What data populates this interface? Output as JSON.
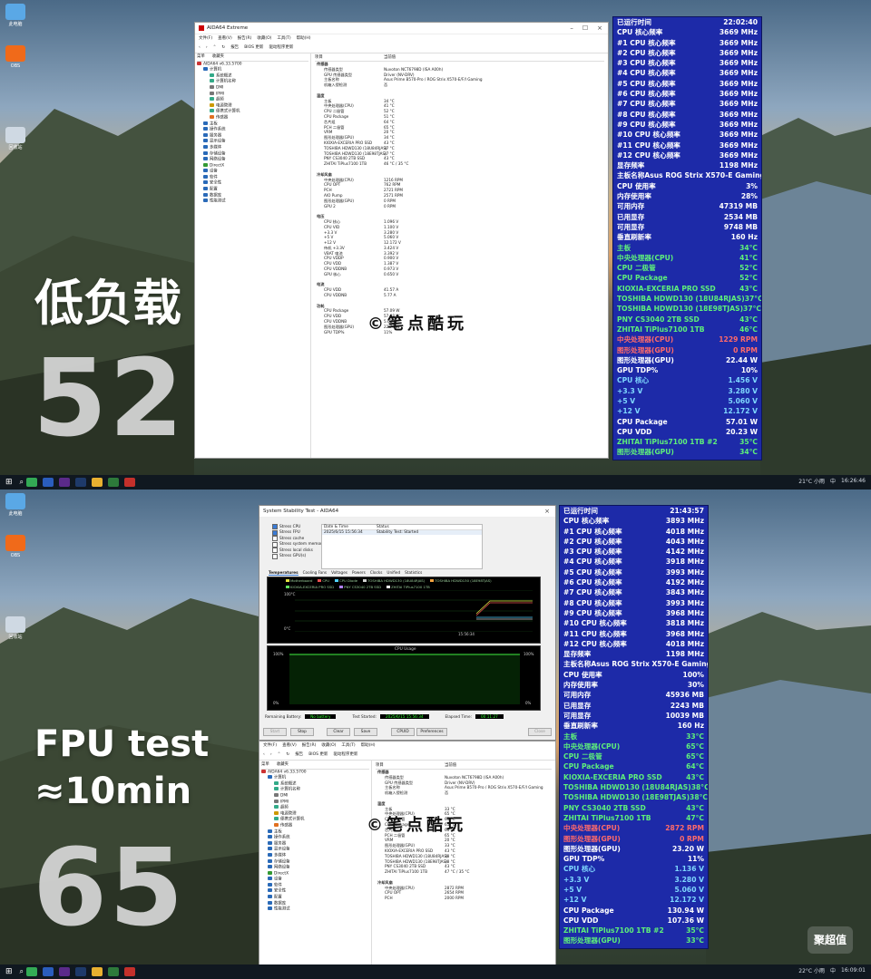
{
  "top": {
    "desktop_icons": [
      "此电脑",
      "OBS",
      "回收站"
    ],
    "overlay_title": "低负载",
    "overlay_number": "52",
    "watermark": "©笔点酷玩",
    "aida": {
      "title": "AIDA64 Extreme",
      "menus": [
        "文件(F)",
        "查看(V)",
        "报告(R)",
        "收藏(O)",
        "工具(T)",
        "帮助(H)"
      ],
      "toolbar": [
        "报告",
        "BIOS 更新",
        "驱动程序更新"
      ],
      "tree_tabs": [
        "菜单",
        "收藏夹"
      ],
      "tree": [
        "AIDA64 v6.33.5700",
        "计算机",
        "系统概述",
        "计算机名称",
        "DMI",
        "IPMI",
        "超频",
        "电源管理",
        "便携式计算机",
        "传感器",
        "主板",
        "操作系统",
        "服务器",
        "显示设备",
        "多媒体",
        "存储设备",
        "网络设备",
        "DirectX",
        "设备",
        "软件",
        "安全性",
        "配置",
        "数据库",
        "性能测试"
      ],
      "col_headers": [
        "项目",
        "当前值"
      ],
      "rows": [
        {
          "k": "传感器",
          "v": "",
          "sec": true
        },
        {
          "k": "传感器类型",
          "v": "Nuvoton NCT6798D (ISA A00h)"
        },
        {
          "k": "GPU 传感器类型",
          "v": "Driver (NV-DRV)"
        },
        {
          "k": "主板名称",
          "v": "Asus Prime B570-Pro / ROG Strix X570-E/F/I Gaming"
        },
        {
          "k": "机箱入侵检测",
          "v": "否"
        },
        {
          "k": "",
          "v": ""
        },
        {
          "k": "温度",
          "v": "",
          "sec": true
        },
        {
          "k": "主板",
          "v": "34 °C"
        },
        {
          "k": "中央处理器(CPU)",
          "v": "41 °C"
        },
        {
          "k": "CPU 二极管",
          "v": "52 °C"
        },
        {
          "k": "CPU Package",
          "v": "51 °C"
        },
        {
          "k": "芯片组",
          "v": "64 °C"
        },
        {
          "k": "PCH 二极管",
          "v": "65 °C"
        },
        {
          "k": "VRM",
          "v": "20 °C"
        },
        {
          "k": "图形处理器(GPU)",
          "v": "34 °C"
        },
        {
          "k": "KIOXIA-EXCERIA PRO SSD",
          "v": "43 °C"
        },
        {
          "k": "TOSHIBA HDWD130 (18U84RJAS)",
          "v": "37 °C"
        },
        {
          "k": "TOSHIBA HDWD130 (18E98TJAS)",
          "v": "37 °C"
        },
        {
          "k": "PNY CS3040 2TB SSD",
          "v": "43 °C"
        },
        {
          "k": "ZHITAI TiPlus7100 1TB",
          "v": "46 °C / 35 °C"
        },
        {
          "k": "",
          "v": ""
        },
        {
          "k": "冷却风扇",
          "v": "",
          "sec": true
        },
        {
          "k": "中央处理器(CPU)",
          "v": "1216 RPM"
        },
        {
          "k": "CPU OPT",
          "v": "762 RPM"
        },
        {
          "k": "PCH",
          "v": "2721 RPM"
        },
        {
          "k": "AIO Pump",
          "v": "2571 RPM"
        },
        {
          "k": "图形处理器(GPU)",
          "v": "0 RPM"
        },
        {
          "k": "GPU 2",
          "v": "0 RPM"
        },
        {
          "k": "",
          "v": ""
        },
        {
          "k": "电压",
          "v": "",
          "sec": true
        },
        {
          "k": "CPU 核心",
          "v": "1.096 V"
        },
        {
          "k": "CPU VID",
          "v": "1.100 V"
        },
        {
          "k": "+3.3 V",
          "v": "3.280 V"
        },
        {
          "k": "+5 V",
          "v": "5.060 V"
        },
        {
          "k": "+12 V",
          "v": "12.172 V"
        },
        {
          "k": "待机 +3.3V",
          "v": "3.424 V"
        },
        {
          "k": "VBAT 电池",
          "v": "3.392 V"
        },
        {
          "k": "CPU VDDP",
          "v": "0.900 V"
        },
        {
          "k": "CPU VDD",
          "v": "1.387 V"
        },
        {
          "k": "CPU VDDNB",
          "v": "0.973 V"
        },
        {
          "k": "GPU 核心",
          "v": "0.650 V"
        },
        {
          "k": "",
          "v": ""
        },
        {
          "k": "电流",
          "v": "",
          "sec": true
        },
        {
          "k": "CPU VDD",
          "v": "41.57 A"
        },
        {
          "k": "CPU VDDNB",
          "v": "5.77 A"
        },
        {
          "k": "",
          "v": ""
        },
        {
          "k": "功耗",
          "v": "",
          "sec": true
        },
        {
          "k": "CPU Package",
          "v": "57.09 W"
        },
        {
          "k": "CPU VDD",
          "v": "57.68 W"
        },
        {
          "k": "CPU VDDNB",
          "v": "5.63 W"
        },
        {
          "k": "图形处理器(GPU)",
          "v": "22.79 W"
        },
        {
          "k": "GPU TDP%",
          "v": "11%"
        }
      ]
    },
    "osd": [
      {
        "k": "已运行时间",
        "v": "22:02:40",
        "c": "#ffffff"
      },
      {
        "k": "CPU 核心频率",
        "v": "3669 MHz",
        "c": "#ffffff"
      },
      {
        "k": "#1 CPU 核心频率",
        "v": "3669 MHz",
        "c": "#ffffff"
      },
      {
        "k": "#2 CPU 核心频率",
        "v": "3669 MHz",
        "c": "#ffffff"
      },
      {
        "k": "#3 CPU 核心频率",
        "v": "3669 MHz",
        "c": "#ffffff"
      },
      {
        "k": "#4 CPU 核心频率",
        "v": "3669 MHz",
        "c": "#ffffff"
      },
      {
        "k": "#5 CPU 核心频率",
        "v": "3669 MHz",
        "c": "#ffffff"
      },
      {
        "k": "#6 CPU 核心频率",
        "v": "3669 MHz",
        "c": "#ffffff"
      },
      {
        "k": "#7 CPU 核心频率",
        "v": "3669 MHz",
        "c": "#ffffff"
      },
      {
        "k": "#8 CPU 核心频率",
        "v": "3669 MHz",
        "c": "#ffffff"
      },
      {
        "k": "#9 CPU 核心频率",
        "v": "3669 MHz",
        "c": "#ffffff"
      },
      {
        "k": "#10 CPU 核心频率",
        "v": "3669 MHz",
        "c": "#ffffff"
      },
      {
        "k": "#11 CPU 核心频率",
        "v": "3669 MHz",
        "c": "#ffffff"
      },
      {
        "k": "#12 CPU 核心频率",
        "v": "3669 MHz",
        "c": "#ffffff"
      },
      {
        "k": "显存频率",
        "v": "1198 MHz",
        "c": "#ffffff"
      },
      {
        "k": "主板名称",
        "v": "Asus ROG Strix X570-E Gaming",
        "c": "#ffffff"
      },
      {
        "k": "CPU 使用率",
        "v": "3%",
        "c": "#ffffff"
      },
      {
        "k": "内存使用率",
        "v": "28%",
        "c": "#ffffff"
      },
      {
        "k": "可用内存",
        "v": "47319 MB",
        "c": "#ffffff"
      },
      {
        "k": "已用显存",
        "v": "2534 MB",
        "c": "#ffffff"
      },
      {
        "k": "可用显存",
        "v": "9748 MB",
        "c": "#ffffff"
      },
      {
        "k": "垂直刷新率",
        "v": "160 Hz",
        "c": "#ffffff"
      },
      {
        "k": "主板",
        "v": "34°C",
        "c": "#5ef07a"
      },
      {
        "k": "中央处理器(CPU)",
        "v": "41°C",
        "c": "#5ef07a"
      },
      {
        "k": "CPU 二极管",
        "v": "52°C",
        "c": "#5ef07a"
      },
      {
        "k": "CPU Package",
        "v": "52°C",
        "c": "#5ef07a"
      },
      {
        "k": "KIOXIA-EXCERIA PRO SSD",
        "v": "43°C",
        "c": "#5ef07a"
      },
      {
        "k": "TOSHIBA HDWD130 (18U84RJAS)",
        "v": "37°C",
        "c": "#5ef07a"
      },
      {
        "k": "TOSHIBA HDWD130 (18E98TJAS)",
        "v": "37°C",
        "c": "#5ef07a"
      },
      {
        "k": "PNY CS3040 2TB SSD",
        "v": "43°C",
        "c": "#5ef07a"
      },
      {
        "k": "ZHITAI TiPlus7100 1TB",
        "v": "46°C",
        "c": "#5ef07a"
      },
      {
        "k": "中央处理器(CPU)",
        "v": "1229 RPM",
        "c": "#ff6a6a"
      },
      {
        "k": "图形处理器(GPU)",
        "v": "0 RPM",
        "c": "#ff6a6a"
      },
      {
        "k": "图形处理器(GPU)",
        "v": "22.44 W",
        "c": "#ffffff"
      },
      {
        "k": "GPU TDP%",
        "v": "10%",
        "c": "#ffffff"
      },
      {
        "k": "CPU 核心",
        "v": "1.456 V",
        "c": "#7fd8ff"
      },
      {
        "k": "+3.3 V",
        "v": "3.280 V",
        "c": "#7fd8ff"
      },
      {
        "k": "+5 V",
        "v": "5.060 V",
        "c": "#7fd8ff"
      },
      {
        "k": "+12 V",
        "v": "12.172 V",
        "c": "#7fd8ff"
      },
      {
        "k": "CPU Package",
        "v": "57.01 W",
        "c": "#ffffff"
      },
      {
        "k": "CPU VDD",
        "v": "20.23 W",
        "c": "#ffffff"
      },
      {
        "k": "ZHITAI TiPlus7100 1TB #2",
        "v": "35°C",
        "c": "#5ef07a"
      },
      {
        "k": "图形处理器(GPU)",
        "v": "34°C",
        "c": "#5ef07a"
      }
    ],
    "tray": {
      "weather": "21°C 小雨",
      "ime": "中",
      "time": "16:26:46"
    }
  },
  "bottom": {
    "desktop_icons": [
      "此电脑",
      "OBS",
      "回收站"
    ],
    "overlay_title_1": "FPU test",
    "overlay_title_2": "≈10min",
    "overlay_number": "65",
    "watermark": "©笔点酷玩",
    "stability": {
      "title": "System Stability Test - AIDA64",
      "checks": [
        {
          "label": "Stress CPU",
          "on": true
        },
        {
          "label": "Stress FPU",
          "on": true
        },
        {
          "label": "Stress cache",
          "on": false
        },
        {
          "label": "Stress system memory",
          "on": false
        },
        {
          "label": "Stress local disks",
          "on": false
        },
        {
          "label": "Stress GPU(s)",
          "on": false
        }
      ],
      "log_headers": [
        "Date & Time",
        "Status"
      ],
      "log_date": "2025/6/15 15:56:34",
      "log_status": "Stability Test: Started",
      "tabs": [
        "Temperatures",
        "Cooling Fans",
        "Voltages",
        "Powers",
        "Clocks",
        "Unified",
        "Statistics"
      ],
      "legend": [
        "Motherboard",
        "CPU",
        "CPU Diode",
        "TOSHIBA HDWD130 (18U84RJAS)",
        "TOSHIBA HDWD130 (18E98TJAS)",
        "KIOXIA-EXCERIA PRO SSD",
        "PNY CS3040 2TB SSD",
        "ZHITAI TiPlus7100 1TB"
      ],
      "graph1_top": "100°C",
      "graph1_bottom": "0°C",
      "graph1_time": "15:56:34",
      "graph2_title": "CPU Usage",
      "graph2_top_left": "100%",
      "graph2_top_right": "100%",
      "graph2_bottom_left": "0%",
      "graph2_bottom_right": "0%",
      "remaining_label": "Remaining Battery:",
      "remaining_value": "No battery",
      "started_label": "Test Started:",
      "started_value": "2025/6/15 15:56:34",
      "elapsed_label": "Elapsed Time:",
      "elapsed_value": "00:11:27",
      "buttons": [
        "Start",
        "Stop",
        "Clear",
        "Save",
        "CPUID",
        "Preferences",
        "Close"
      ]
    },
    "aida": {
      "menus": [
        "文件(F)",
        "查看(V)",
        "报告(R)",
        "收藏(O)",
        "工具(T)",
        "帮助(H)"
      ],
      "toolbar": [
        "报告",
        "BIOS 更新",
        "驱动程序更新"
      ],
      "tree_tabs": [
        "菜单",
        "收藏夹"
      ],
      "tree": [
        "AIDA64 v6.33.5700",
        "计算机",
        "系统概述",
        "计算机名称",
        "DMI",
        "IPMI",
        "超频",
        "电源管理",
        "便携式计算机",
        "传感器",
        "主板",
        "操作系统",
        "服务器",
        "显示设备",
        "多媒体",
        "存储设备",
        "网络设备",
        "DirectX",
        "设备",
        "软件",
        "安全性",
        "配置",
        "数据库",
        "性能测试"
      ],
      "col_headers": [
        "项目",
        "当前值"
      ],
      "rows": [
        {
          "k": "传感器",
          "v": "",
          "sec": true
        },
        {
          "k": "传感器类型",
          "v": "Nuvoton NCT6798D (ISA A00h)"
        },
        {
          "k": "GPU 传感器类型",
          "v": "Driver (NV-DRV)"
        },
        {
          "k": "主板名称",
          "v": "Asus Prime B570-Pro / ROG Strix X570-E/F/I Gaming"
        },
        {
          "k": "机箱入侵检测",
          "v": "否"
        },
        {
          "k": "",
          "v": ""
        },
        {
          "k": "温度",
          "v": "",
          "sec": true
        },
        {
          "k": "主板",
          "v": "33 °C"
        },
        {
          "k": "中央处理器(CPU)",
          "v": "65 °C"
        },
        {
          "k": "CPU 二极管",
          "v": "65 °C"
        },
        {
          "k": "CPU Package",
          "v": "65 °C"
        },
        {
          "k": "芯片组",
          "v": "65 °C"
        },
        {
          "k": "PCH 二极管",
          "v": "65 °C"
        },
        {
          "k": "VRM",
          "v": "20 °C"
        },
        {
          "k": "图形处理器(GPU)",
          "v": "33 °C"
        },
        {
          "k": "KIOXIA-EXCERIA PRO SSD",
          "v": "43 °C"
        },
        {
          "k": "TOSHIBA HDWD130 (18U84RJAS)",
          "v": "38 °C"
        },
        {
          "k": "TOSHIBA HDWD130 (18E98TJAS)",
          "v": "38 °C"
        },
        {
          "k": "PNY CS3040 2TB SSD",
          "v": "43 °C"
        },
        {
          "k": "ZHITAI TiPlus7100 1TB",
          "v": "47 °C / 35 °C"
        },
        {
          "k": "",
          "v": ""
        },
        {
          "k": "冷却风扇",
          "v": "",
          "sec": true
        },
        {
          "k": "中央处理器(CPU)",
          "v": "2872 RPM"
        },
        {
          "k": "CPU OPT",
          "v": "2654 RPM"
        },
        {
          "k": "PCH",
          "v": "2000 RPM"
        }
      ]
    },
    "osd": [
      {
        "k": "已运行时间",
        "v": "21:43:57",
        "c": "#ffffff"
      },
      {
        "k": "CPU 核心频率",
        "v": "3893 MHz",
        "c": "#ffffff"
      },
      {
        "k": "#1 CPU 核心频率",
        "v": "4018 MHz",
        "c": "#ffffff"
      },
      {
        "k": "#2 CPU 核心频率",
        "v": "4043 MHz",
        "c": "#ffffff"
      },
      {
        "k": "#3 CPU 核心频率",
        "v": "4142 MHz",
        "c": "#ffffff"
      },
      {
        "k": "#4 CPU 核心频率",
        "v": "3918 MHz",
        "c": "#ffffff"
      },
      {
        "k": "#5 CPU 核心频率",
        "v": "3993 MHz",
        "c": "#ffffff"
      },
      {
        "k": "#6 CPU 核心频率",
        "v": "4192 MHz",
        "c": "#ffffff"
      },
      {
        "k": "#7 CPU 核心频率",
        "v": "3843 MHz",
        "c": "#ffffff"
      },
      {
        "k": "#8 CPU 核心频率",
        "v": "3993 MHz",
        "c": "#ffffff"
      },
      {
        "k": "#9 CPU 核心频率",
        "v": "3968 MHz",
        "c": "#ffffff"
      },
      {
        "k": "#10 CPU 核心频率",
        "v": "3818 MHz",
        "c": "#ffffff"
      },
      {
        "k": "#11 CPU 核心频率",
        "v": "3968 MHz",
        "c": "#ffffff"
      },
      {
        "k": "#12 CPU 核心频率",
        "v": "4018 MHz",
        "c": "#ffffff"
      },
      {
        "k": "显存频率",
        "v": "1198 MHz",
        "c": "#ffffff"
      },
      {
        "k": "主板名称",
        "v": "Asus ROG Strix X570-E Gaming",
        "c": "#ffffff"
      },
      {
        "k": "CPU 使用率",
        "v": "100%",
        "c": "#ffffff"
      },
      {
        "k": "内存使用率",
        "v": "30%",
        "c": "#ffffff"
      },
      {
        "k": "可用内存",
        "v": "45936 MB",
        "c": "#ffffff"
      },
      {
        "k": "已用显存",
        "v": "2243 MB",
        "c": "#ffffff"
      },
      {
        "k": "可用显存",
        "v": "10039 MB",
        "c": "#ffffff"
      },
      {
        "k": "垂直刷新率",
        "v": "160 Hz",
        "c": "#ffffff"
      },
      {
        "k": "主板",
        "v": "33°C",
        "c": "#5ef07a"
      },
      {
        "k": "中央处理器(CPU)",
        "v": "65°C",
        "c": "#5ef07a"
      },
      {
        "k": "CPU 二极管",
        "v": "65°C",
        "c": "#5ef07a"
      },
      {
        "k": "CPU Package",
        "v": "64°C",
        "c": "#5ef07a"
      },
      {
        "k": "KIOXIA-EXCERIA PRO SSD",
        "v": "43°C",
        "c": "#5ef07a"
      },
      {
        "k": "TOSHIBA HDWD130 (18U84RJAS)",
        "v": "38°C",
        "c": "#5ef07a"
      },
      {
        "k": "TOSHIBA HDWD130 (18E98TJAS)",
        "v": "38°C",
        "c": "#5ef07a"
      },
      {
        "k": "PNY CS3040 2TB SSD",
        "v": "43°C",
        "c": "#5ef07a"
      },
      {
        "k": "ZHITAI TiPlus7100 1TB",
        "v": "47°C",
        "c": "#5ef07a"
      },
      {
        "k": "中央处理器(CPU)",
        "v": "2872 RPM",
        "c": "#ff6a6a"
      },
      {
        "k": "图形处理器(GPU)",
        "v": "0 RPM",
        "c": "#ff6a6a"
      },
      {
        "k": "图形处理器(GPU)",
        "v": "23.20 W",
        "c": "#ffffff"
      },
      {
        "k": "GPU TDP%",
        "v": "11%",
        "c": "#ffffff"
      },
      {
        "k": "CPU 核心",
        "v": "1.136 V",
        "c": "#7fd8ff"
      },
      {
        "k": "+3.3 V",
        "v": "3.280 V",
        "c": "#7fd8ff"
      },
      {
        "k": "+5 V",
        "v": "5.060 V",
        "c": "#7fd8ff"
      },
      {
        "k": "+12 V",
        "v": "12.172 V",
        "c": "#7fd8ff"
      },
      {
        "k": "CPU Package",
        "v": "130.94 W",
        "c": "#ffffff"
      },
      {
        "k": "CPU VDD",
        "v": "107.36 W",
        "c": "#ffffff"
      },
      {
        "k": "ZHITAI TiPlus7100 1TB #2",
        "v": "35°C",
        "c": "#5ef07a"
      },
      {
        "k": "图形处理器(GPU)",
        "v": "33°C",
        "c": "#5ef07a"
      }
    ],
    "tray": {
      "weather": "22°C 小雨",
      "ime": "中",
      "time": "16:09:01"
    },
    "corner_logo": "聚超值"
  },
  "colors": {
    "osd_bg": "#1d2aa8",
    "osd_label": "#ffffff",
    "osd_temp": "#5ef07a",
    "osd_fan": "#ff6a6a",
    "osd_volt": "#7fd8ff"
  }
}
